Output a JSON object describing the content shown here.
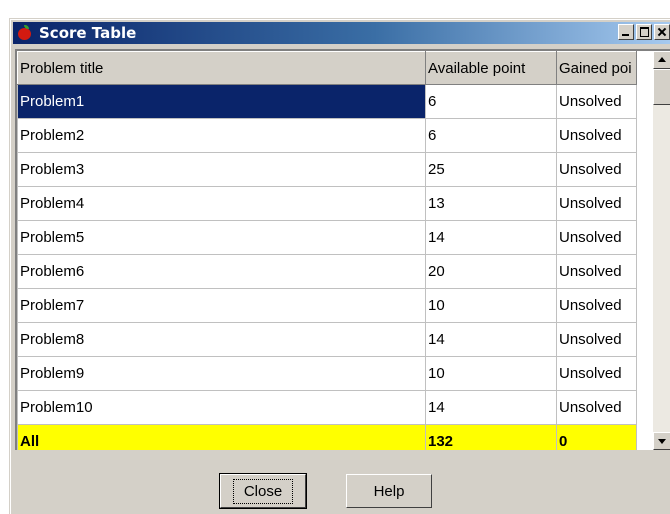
{
  "window": {
    "title": "Score Table"
  },
  "table": {
    "columns": [
      "Problem title",
      "Available point",
      "Gained poi"
    ],
    "rows": [
      [
        "Problem1",
        "6",
        "Unsolved"
      ],
      [
        "Problem2",
        "6",
        "Unsolved"
      ],
      [
        "Problem3",
        "25",
        "Unsolved"
      ],
      [
        "Problem4",
        "13",
        "Unsolved"
      ],
      [
        "Problem5",
        "14",
        "Unsolved"
      ],
      [
        "Problem6",
        "20",
        "Unsolved"
      ],
      [
        "Problem7",
        "10",
        "Unsolved"
      ],
      [
        "Problem8",
        "14",
        "Unsolved"
      ],
      [
        "Problem9",
        "10",
        "Unsolved"
      ],
      [
        "Problem10",
        "14",
        "Unsolved"
      ]
    ],
    "total": [
      "All",
      "132",
      "0"
    ],
    "selected_row": "Problem1"
  },
  "buttons": {
    "close": "Close",
    "help": "Help"
  },
  "colors": {
    "selection": "#0a246a",
    "total_row": "#ffff00",
    "face": "#d4d0c8"
  },
  "icons": [
    "apple-icon",
    "minimize-icon",
    "maximize-icon",
    "close-icon",
    "scroll-up-icon",
    "scroll-down-icon"
  ]
}
